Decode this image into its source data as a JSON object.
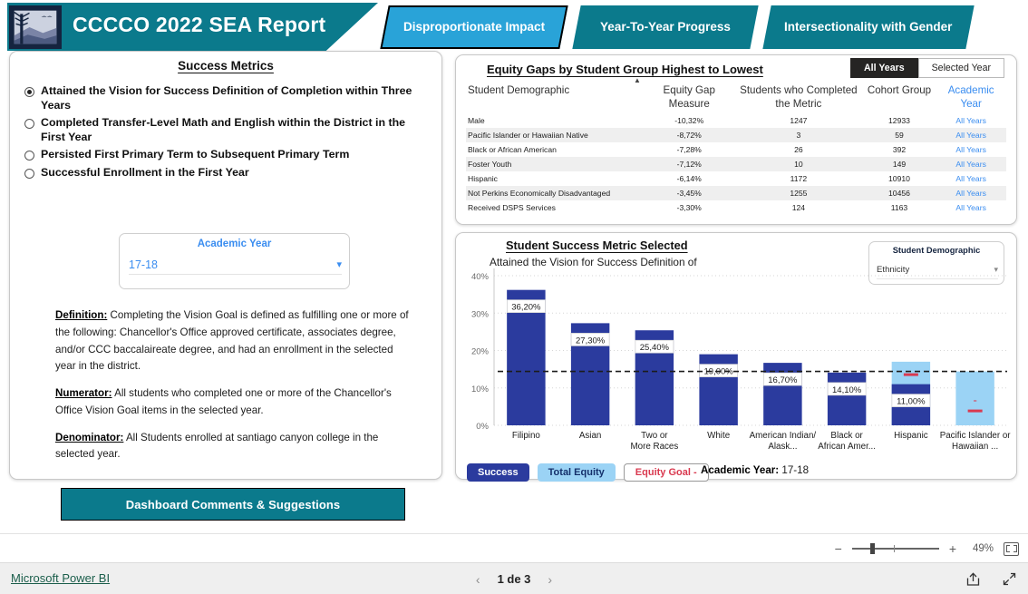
{
  "header": {
    "logo_icon": "college-landscape-logo",
    "title": "CCCCO 2022 SEA Report",
    "tabs": [
      {
        "label": "Disproportionate Impact",
        "active": true
      },
      {
        "label": "Year-To-Year Progress",
        "active": false
      },
      {
        "label": "Intersectionality with Gender",
        "active": false
      }
    ]
  },
  "left_panel": {
    "title": "Success Metrics",
    "metrics": [
      {
        "label": "Attained the Vision for Success Definition of Completion within Three Years",
        "selected": true
      },
      {
        "label": "Completed Transfer-Level Math and English within the District in the First Year",
        "selected": false
      },
      {
        "label": "Persisted First Primary Term to Subsequent Primary Term",
        "selected": false
      },
      {
        "label": "Successful Enrollment in the First Year",
        "selected": false
      }
    ],
    "year_slicer": {
      "label": "Academic Year",
      "value": "17-18",
      "chevron_icon": "chevron-down-icon"
    },
    "definition_label": "Definition:",
    "definition_text": " Completing the Vision Goal is defined as fulfilling one or more of the following: Chancellor's Office approved certificate, associates degree, and/or CCC baccalaireate degree, and had an enrollment in the selected year in the district.",
    "numerator_label": "Numerator:",
    "numerator_text": " All students who completed one or more of the Chancellor's Office Vision Goal items in the selected year.",
    "denominator_label": "Denominator:",
    "denominator_text": " All Students enrolled at santiago canyon college in the selected year.",
    "comments_button": "Dashboard Comments & Suggestions"
  },
  "table_panel": {
    "title": "Equity Gaps by Student Group Highest to Lowest",
    "toggle": [
      {
        "label": "All Years",
        "active": true
      },
      {
        "label": "Selected Year",
        "active": false
      }
    ],
    "columns": [
      "Student Demographic",
      "Equity Gap Measure",
      "Students who Completed the Metric",
      "Cohort Group",
      "Academic Year"
    ],
    "sort_icon": "sort-ascending-caret",
    "rows": [
      {
        "demographic": "Male",
        "gap": "-10,32%",
        "completed": "1247",
        "cohort": "12933",
        "year": "All Years"
      },
      {
        "demographic": "Pacific Islander or Hawaiian Native",
        "gap": "-8,72%",
        "completed": "3",
        "cohort": "59",
        "year": "All Years"
      },
      {
        "demographic": "Black or African American",
        "gap": "-7,28%",
        "completed": "26",
        "cohort": "392",
        "year": "All Years"
      },
      {
        "demographic": "Foster Youth",
        "gap": "-7,12%",
        "completed": "10",
        "cohort": "149",
        "year": "All Years"
      },
      {
        "demographic": "Hispanic",
        "gap": "-6,14%",
        "completed": "1172",
        "cohort": "10910",
        "year": "All Years"
      },
      {
        "demographic": "Not Perkins Economically Disadvantaged",
        "gap": "-3,45%",
        "completed": "1255",
        "cohort": "10456",
        "year": "All Years"
      },
      {
        "demographic": "Received DSPS Services",
        "gap": "-3,30%",
        "completed": "124",
        "cohort": "1163",
        "year": "All Years"
      }
    ]
  },
  "chart_panel": {
    "title": "Student Success Metric Selected",
    "subtitle": "Attained the Vision for Success Definition of",
    "demographic_slicer": {
      "label": "Student Demographic",
      "value": "Ethnicity",
      "chevron_icon": "chevron-down-icon"
    },
    "legend": [
      {
        "label": "Success",
        "color": "#2b3b9e"
      },
      {
        "label": "Total Equity",
        "color": "#9bd3f5"
      },
      {
        "label": "Equity Goal -",
        "color": "#d9394f"
      }
    ],
    "academic_year_label": "Academic Year:",
    "academic_year_value": "17-18"
  },
  "chart_data": {
    "type": "bar",
    "title": "Student Success Metric Selected",
    "subtitle": "Attained the Vision for Success Definition of",
    "xlabel": "",
    "ylabel": "",
    "ylim": [
      0,
      40
    ],
    "yticks": [
      0,
      10,
      20,
      30,
      40
    ],
    "ytick_labels": [
      "0%",
      "10%",
      "20%",
      "30%",
      "40%"
    ],
    "grid": true,
    "legend_position": "bottom-left",
    "goal_line": {
      "value": 14.4,
      "style": "dashed",
      "color": "#1c1c1c",
      "label": "Equity Goal"
    },
    "categories": [
      "Filipino",
      "Asian",
      "Two or More Races",
      "White",
      "American Indian/ Alask...",
      "Black or African Amer...",
      "Hispanic",
      "Pacific Islander or Hawaiian ..."
    ],
    "series": [
      {
        "name": "Success",
        "color": "#2b3b9e",
        "values": [
          36.2,
          27.3,
          25.4,
          19.0,
          16.7,
          14.1,
          11.0,
          null
        ],
        "labels": [
          "36,20%",
          "27,30%",
          "25,40%",
          "19,00%",
          "16,70%",
          "14,10%",
          "11,00%",
          "-"
        ]
      },
      {
        "name": "Total Equity",
        "color": "#9bd3f5",
        "values": [
          null,
          null,
          null,
          null,
          null,
          null,
          17.0,
          14.4
        ]
      }
    ]
  },
  "zoom_bar": {
    "minus_icon": "zoom-out-icon",
    "plus_icon": "zoom-in-icon",
    "percent": "49%",
    "fit_icon": "fit-to-page-icon"
  },
  "footer": {
    "brand_link": "Microsoft Power BI",
    "prev_icon": "chevron-left-icon",
    "next_icon": "chevron-right-icon",
    "page_label": "1 de 3",
    "share_icon": "share-icon",
    "fullscreen_icon": "fullscreen-icon"
  }
}
